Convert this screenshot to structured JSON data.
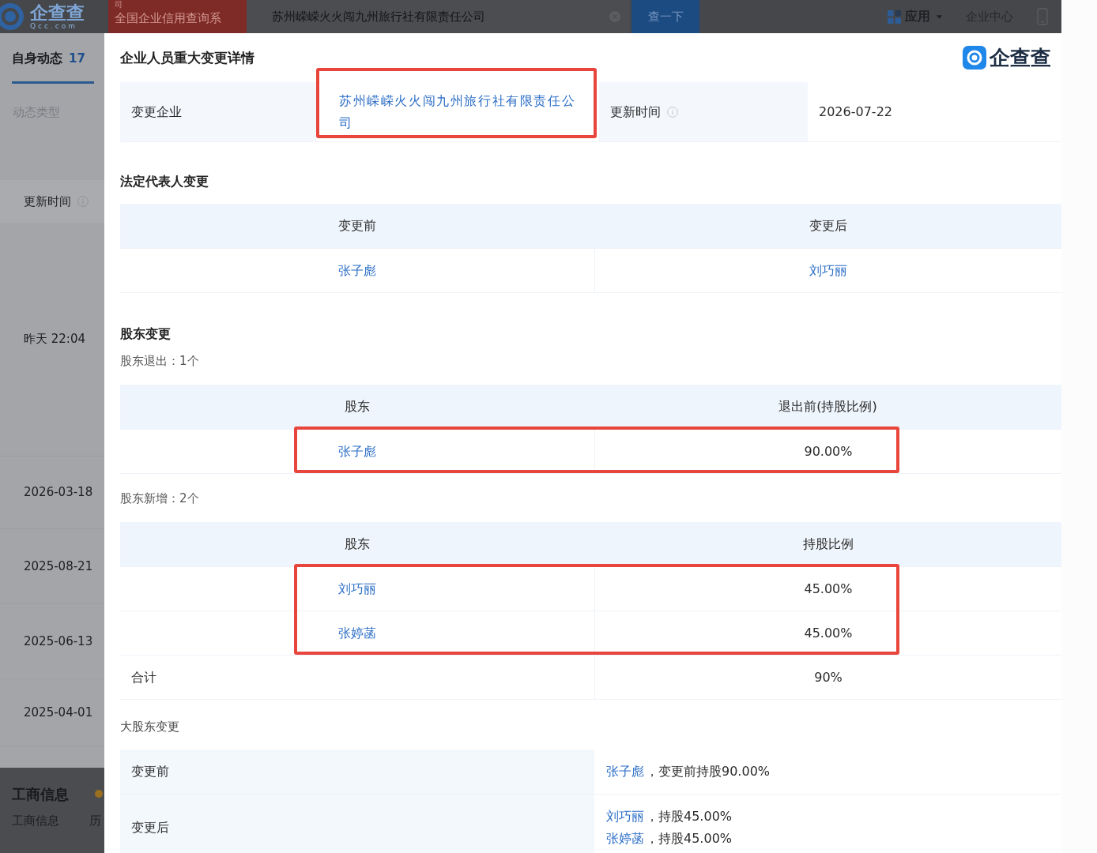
{
  "top_bar": {
    "logo_text": "企查查",
    "logo_domain": "Qcc.com",
    "banner_lines": [
      "司",
      "全国企业信用查询系"
    ],
    "search": {
      "value": "苏州嵘嵘火火闯九州旅行社有限责任公司"
    },
    "search_button": "查一下",
    "menu": [
      {
        "label": "应用",
        "kind": "dropdown"
      },
      {
        "label": "企业中心",
        "kind": "link"
      }
    ]
  },
  "sidebar": {
    "tab": {
      "label": "自身动态",
      "count": "17",
      "selected": true
    },
    "filter_label": "动态类型",
    "column_header": "更新时间",
    "times": [
      "昨天 22:04",
      "2026-03-18",
      "2025-08-21",
      "2025-06-13",
      "2025-04-01"
    ],
    "section": {
      "title": "工商信息",
      "dot": true,
      "items": [
        "工商信息",
        "历"
      ]
    }
  },
  "modal": {
    "title": "企业人员重大变更详情",
    "brand": "企查查",
    "info": [
      {
        "label": "变更企业",
        "value": "苏州嵘嵘火火闯九州旅行社有限责任公司",
        "link": true,
        "highlighted": true,
        "info_icon": false
      },
      {
        "label": "更新时间",
        "value": "2026-07-22",
        "link": false,
        "highlighted": false,
        "info_icon": true
      }
    ],
    "legal_rep_change": {
      "title": "法定代表人变更",
      "table": {
        "columns": [
          "变更前",
          "变更后"
        ],
        "rows": [
          {
            "kind": "entry",
            "highlighted": false,
            "cells": [
              {
                "text": "张子彪",
                "link": true
              },
              {
                "text": "刘巧丽",
                "link": true
              }
            ]
          }
        ]
      }
    },
    "shareholder_change": {
      "title": "股东变更",
      "groups": [
        {
          "caption": "股东退出：1个",
          "table": {
            "columns": [
              "股东",
              "退出前(持股比例)"
            ],
            "rows": [
              {
                "kind": "entry",
                "highlighted": true,
                "cells": [
                  {
                    "text": "张子彪",
                    "link": true
                  },
                  {
                    "text": "90.00%",
                    "link": false
                  }
                ]
              }
            ]
          }
        },
        {
          "caption": "股东新增：2个",
          "table": {
            "columns": [
              "股东",
              "持股比例"
            ],
            "rows": [
              {
                "kind": "entry",
                "highlighted": true,
                "cells": [
                  {
                    "text": "刘巧丽",
                    "link": true
                  },
                  {
                    "text": "45.00%",
                    "link": false
                  }
                ]
              },
              {
                "kind": "entry",
                "highlighted": true,
                "cells": [
                  {
                    "text": "张婷菡",
                    "link": true
                  },
                  {
                    "text": "45.00%",
                    "link": false
                  }
                ]
              },
              {
                "kind": "total",
                "highlighted": false,
                "cells": [
                  {
                    "text": "合计",
                    "link": false
                  },
                  {
                    "text": "90%",
                    "link": false
                  }
                ]
              }
            ]
          }
        }
      ]
    },
    "major_shareholder_change": {
      "title": "大股东变更",
      "rows": [
        {
          "label": "变更前",
          "entries": [
            {
              "name": "张子彪",
              "note": "，变更前持股90.00%"
            }
          ]
        },
        {
          "label": "变更后",
          "entries": [
            {
              "name": "刘巧丽",
              "note": "，持股45.00%"
            },
            {
              "name": "张婷菡",
              "note": "，持股45.00%"
            }
          ]
        }
      ]
    }
  }
}
